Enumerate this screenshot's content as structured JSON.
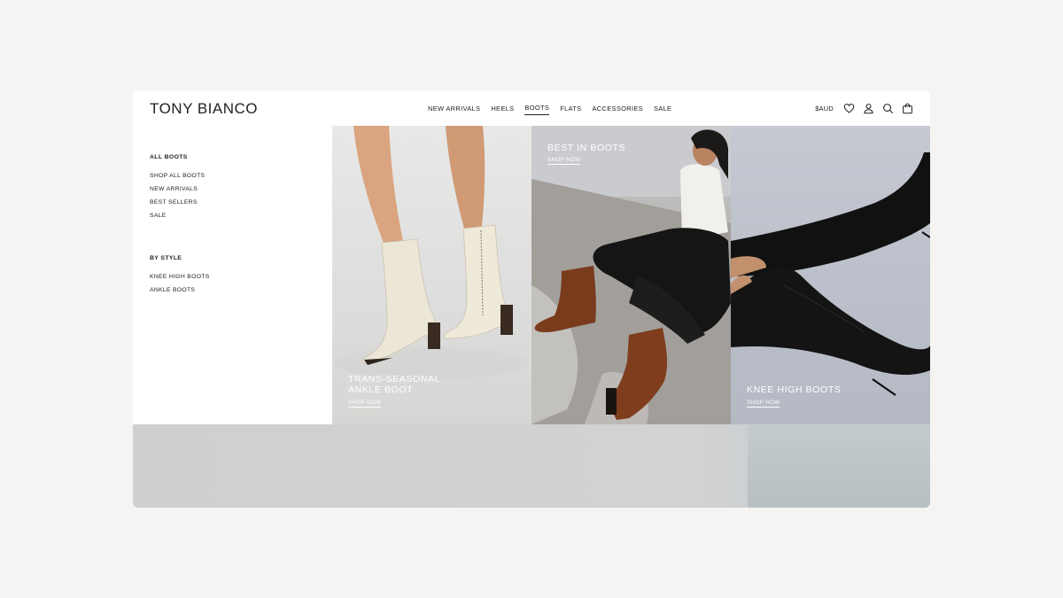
{
  "brand": {
    "logo": "TONY BIANCO"
  },
  "nav": {
    "items": [
      {
        "label": "NEW ARRIVALS",
        "active": false
      },
      {
        "label": "HEELS",
        "active": false
      },
      {
        "label": "BOOTS",
        "active": true
      },
      {
        "label": "FLATS",
        "active": false
      },
      {
        "label": "ACCESSORIES",
        "active": false
      },
      {
        "label": "SALE",
        "active": false
      }
    ]
  },
  "utils": {
    "currency": "$AUD",
    "icons": [
      "heart-icon",
      "user-icon",
      "search-icon",
      "bag-icon"
    ]
  },
  "menu": {
    "section1": {
      "heading": "ALL BOOTS",
      "links": [
        "SHOP ALL BOOTS",
        "NEW ARRIVALS",
        "BEST SELLERS",
        "SALE"
      ]
    },
    "section2": {
      "heading": "BY STYLE",
      "links": [
        "KNEE HIGH BOOTS",
        "ANKLE BOOTS"
      ]
    }
  },
  "tiles": [
    {
      "label_line1": "TRANS-SEASONAL",
      "label_line2": "ANKLE BOOT",
      "cta": "SHOP NOW"
    },
    {
      "label_line1": "BEST IN BOOTS",
      "cta": "SHOP NOW"
    },
    {
      "label_line1": "KNEE HIGH BOOTS",
      "cta": "SHOP NOW"
    }
  ],
  "colors": {
    "page_bg": "#f5f4f2",
    "text": "#222222",
    "white": "#ffffff",
    "cream_boot": "#ece6d6",
    "tan_boot": "#7a3a1c",
    "black_boot": "#111111"
  }
}
